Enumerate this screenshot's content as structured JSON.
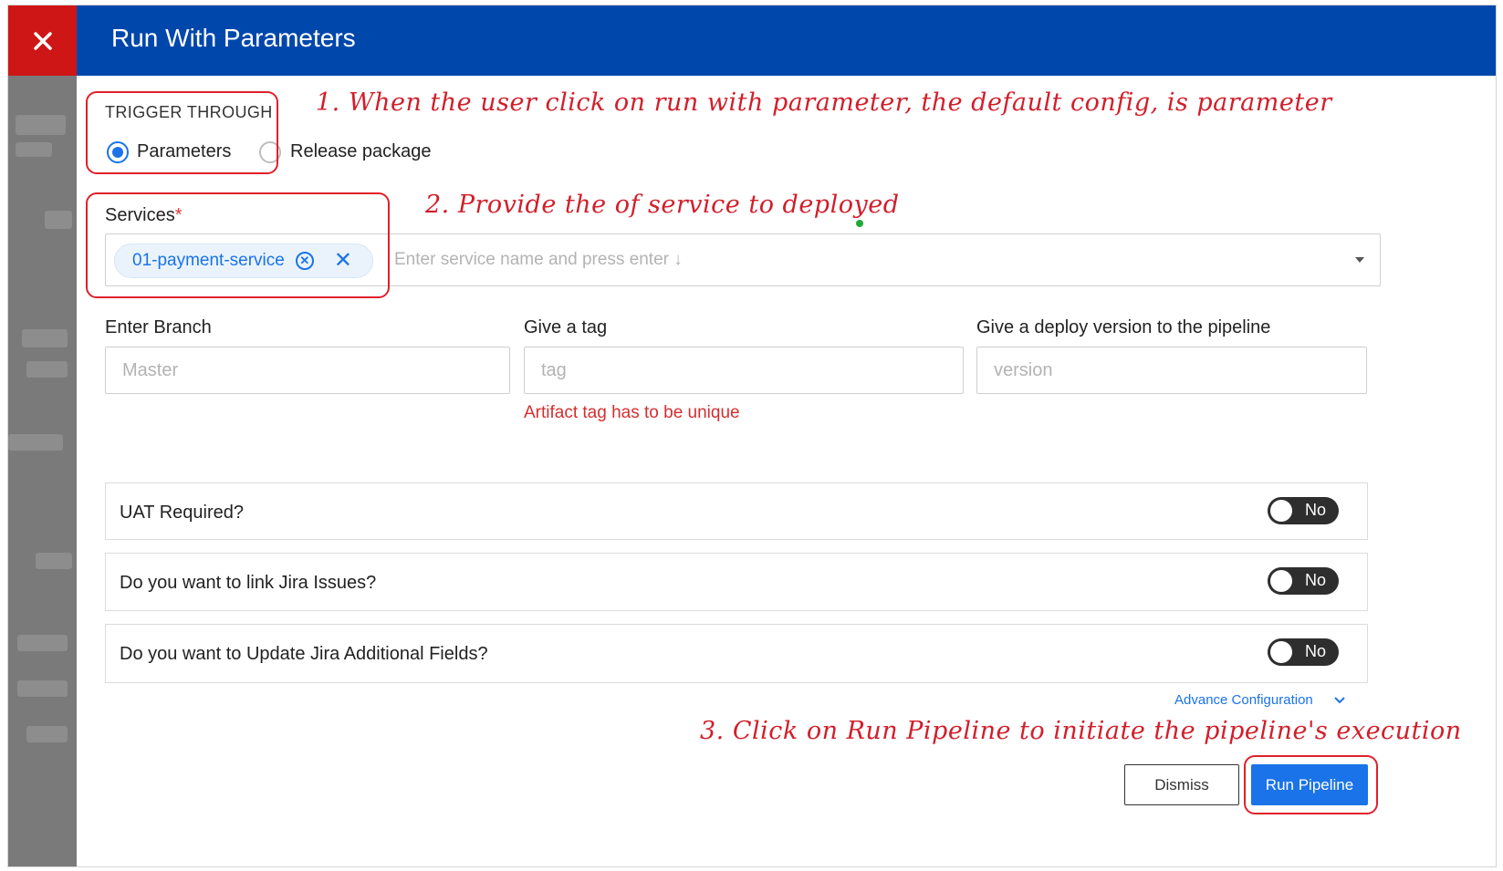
{
  "dialog": {
    "title": "Run With Parameters",
    "close_icon": "close-icon"
  },
  "trigger": {
    "heading": "TRIGGER THROUGH",
    "options": [
      {
        "label": "Parameters",
        "selected": true
      },
      {
        "label": "Release package",
        "selected": false
      }
    ]
  },
  "services": {
    "label": "Services",
    "required_mark": "*",
    "chips": [
      {
        "label": "01-payment-service"
      }
    ],
    "placeholder": "Enter service name and press enter ↓"
  },
  "branch": {
    "label": "Enter Branch",
    "placeholder": "Master"
  },
  "tag": {
    "label": "Give a tag",
    "placeholder": "tag",
    "error": "Artifact tag has to be unique"
  },
  "version": {
    "label": "Give a deploy version to the pipeline",
    "placeholder": "version"
  },
  "toggles": [
    {
      "label": "UAT Required?",
      "value": "No"
    },
    {
      "label": "Do you want to link Jira Issues?",
      "value": "No"
    },
    {
      "label": "Do you want to Update Jira Additional Fields?",
      "value": "No"
    }
  ],
  "advance_config": {
    "label": "Advance Configuration",
    "icon": "chevron-down-icon"
  },
  "buttons": {
    "dismiss": "Dismiss",
    "run": "Run Pipeline"
  },
  "annotations": [
    "1. When the user click on run with parameter, the default config, is parameter",
    "2. Provide the of service to deployed",
    "3. Click on Run Pipeline to initiate the pipeline's execution"
  ],
  "colors": {
    "header": "#0047ab",
    "close": "#cf1616",
    "accent": "#1a73e8",
    "annotation": "#d11f2b",
    "error": "#d32f2f"
  }
}
